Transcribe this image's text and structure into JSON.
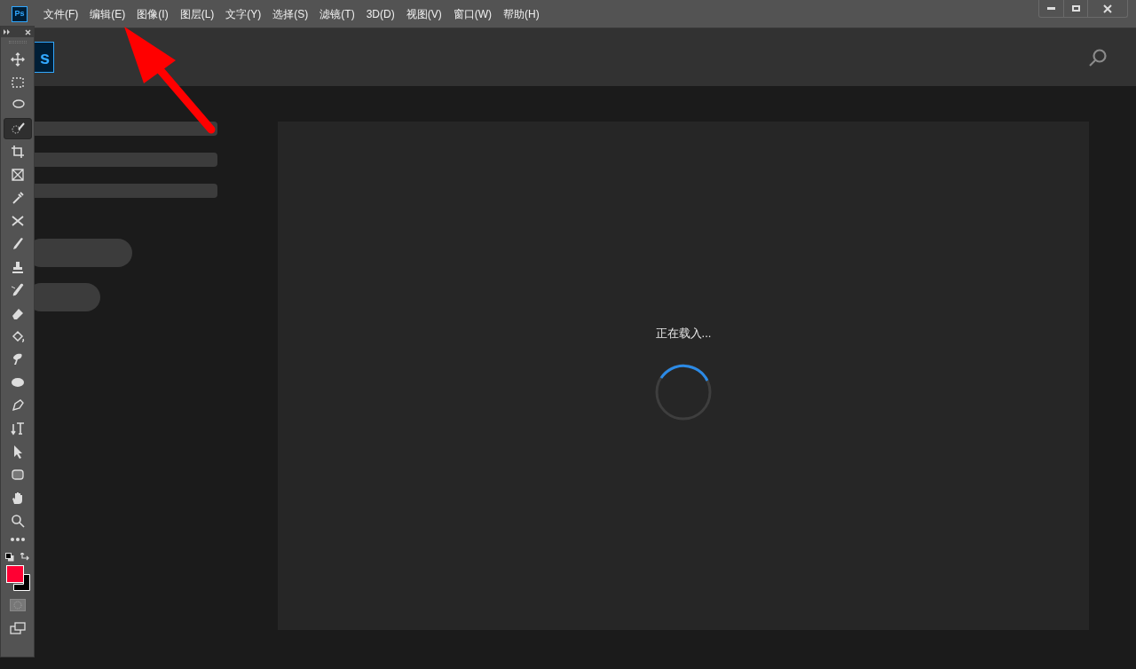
{
  "app_logo": "Ps",
  "menu": [
    "文件(F)",
    "编辑(E)",
    "图像(I)",
    "图层(L)",
    "文字(Y)",
    "选择(S)",
    "滤镜(T)",
    "3D(D)",
    "视图(V)",
    "窗口(W)",
    "帮助(H)"
  ],
  "home": {
    "logo": "s",
    "loading_text": "正在载入..."
  },
  "tools": [
    {
      "selected": false
    },
    {
      "selected": false
    },
    {
      "selected": false
    },
    {
      "selected": true
    },
    {
      "selected": false
    },
    {
      "selected": false
    },
    {
      "selected": false
    },
    {
      "selected": false
    },
    {
      "selected": false
    },
    {
      "selected": false
    },
    {
      "selected": false
    },
    {
      "selected": false
    },
    {
      "selected": false
    },
    {
      "selected": false
    },
    {
      "selected": false
    },
    {
      "selected": false
    },
    {
      "selected": false
    },
    {
      "selected": false
    },
    {
      "selected": false
    },
    {
      "selected": false
    },
    {
      "selected": false
    }
  ],
  "color_swatches": [
    {
      "kind": "foreground",
      "color": "#ff0033"
    },
    {
      "kind": "background",
      "color": "#000000"
    }
  ]
}
